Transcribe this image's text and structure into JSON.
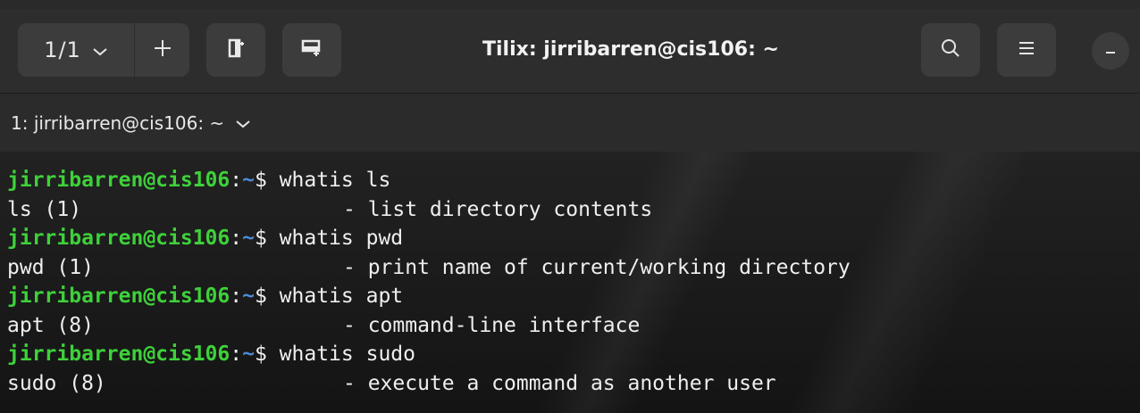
{
  "header": {
    "session_counter": "1/1",
    "title": "Tilix: jirribarren@cis106: ~",
    "icons": [
      "chevron-down-icon",
      "plus-icon",
      "add-terminal-right-icon",
      "add-terminal-down-icon",
      "search-icon",
      "hamburger-menu-icon",
      "minimize-icon"
    ]
  },
  "terminal_tab": {
    "label": "1: jirribarren@cis106: ~"
  },
  "prompt": {
    "user_host": "jirribarren@cis106",
    "colon": ":",
    "path": "~",
    "dollar": "$ "
  },
  "lines": [
    {
      "type": "prompt",
      "command": "whatis ls"
    },
    {
      "type": "output",
      "name": "ls (1)",
      "desc": "- list directory contents"
    },
    {
      "type": "prompt",
      "command": "whatis pwd"
    },
    {
      "type": "output",
      "name": "pwd (1)",
      "desc": "- print name of current/working directory"
    },
    {
      "type": "prompt",
      "command": "whatis apt"
    },
    {
      "type": "output",
      "name": "apt (8)",
      "desc": "- command-line interface"
    },
    {
      "type": "prompt",
      "command": "whatis sudo"
    },
    {
      "type": "output",
      "name": "sudo (8)",
      "desc": "- execute a command as another user"
    }
  ],
  "colors": {
    "prompt_user": "#3ed13a",
    "prompt_path": "#4a8cd6",
    "text": "#efefef"
  }
}
